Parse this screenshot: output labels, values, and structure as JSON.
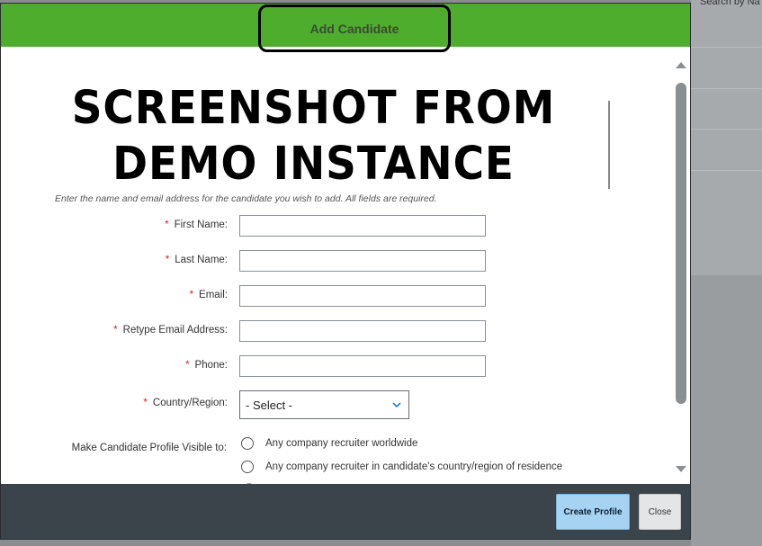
{
  "background": {
    "search_text": "Search by Na"
  },
  "dialog": {
    "title": "Add Candidate",
    "watermark_line1": "SCREENSHOT FROM",
    "watermark_line2": "DEMO INSTANCE",
    "intro_text": "Enter the name and email address for the candidate you wish to add. All fields are required.",
    "fields": [
      {
        "label": "First Name:",
        "required": true,
        "value": ""
      },
      {
        "label": "Last Name:",
        "required": true,
        "value": ""
      },
      {
        "label": "Email:",
        "required": true,
        "value": ""
      },
      {
        "label": "Retype Email Address:",
        "required": true,
        "value": ""
      },
      {
        "label": "Phone:",
        "required": true,
        "value": ""
      }
    ],
    "required_marker": "*",
    "country": {
      "label": "Country/Region:",
      "selected": "- Select -"
    },
    "visibility": {
      "label": "Make Candidate Profile Visible to:",
      "options": [
        "Any company recruiter worldwide",
        "Any company recruiter in candidate's country/region of residence"
      ]
    },
    "buttons": {
      "create": "Create Profile",
      "close": "Close"
    }
  },
  "colors": {
    "header_green": "#4fad2e",
    "footer_dark": "#3b434b",
    "primary_button": "#a7d3f3",
    "required_red": "#d0271d"
  },
  "icons": {
    "scroll_up": "triangle-up",
    "scroll_down": "triangle-down",
    "select_chevron": "chevron-down"
  }
}
